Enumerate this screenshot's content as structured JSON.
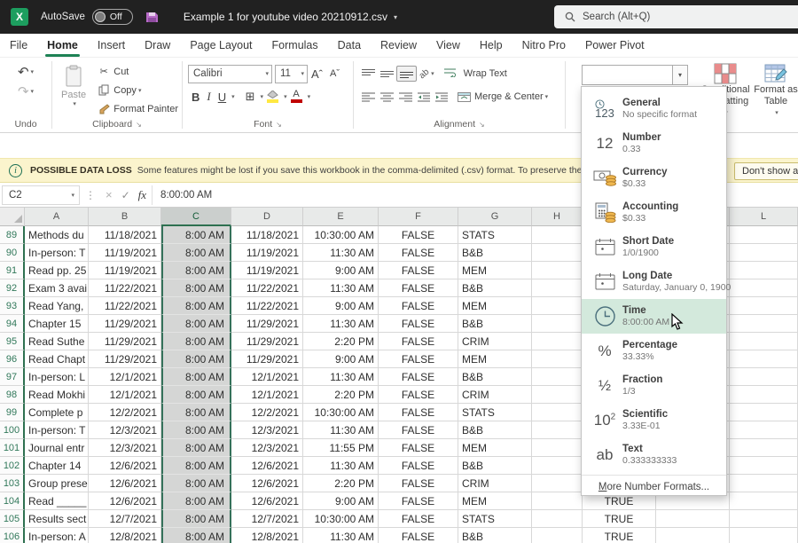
{
  "titlebar": {
    "autosave_label": "AutoSave",
    "autosave_state": "Off",
    "filename": "Example 1 for youtube video 20210912.csv",
    "search_placeholder": "Search (Alt+Q)"
  },
  "tabs": {
    "items": [
      "File",
      "Home",
      "Insert",
      "Draw",
      "Page Layout",
      "Formulas",
      "Data",
      "Review",
      "View",
      "Help",
      "Nitro Pro",
      "Power Pivot"
    ],
    "active": "Home"
  },
  "ribbon": {
    "undo": {
      "label": "Undo"
    },
    "clipboard": {
      "label": "Clipboard",
      "paste": "Paste",
      "cut": "Cut",
      "copy": "Copy",
      "format_painter": "Format Painter"
    },
    "font": {
      "label": "Font",
      "font_name": "Calibri",
      "font_size": "11"
    },
    "alignment": {
      "label": "Alignment",
      "wrap_text": "Wrap Text",
      "merge_center": "Merge & Center"
    },
    "number": {
      "combobox_value": ""
    },
    "styles": {
      "conditional_formatting": "Conditional Formatting",
      "format_as_table": "Format as Table"
    }
  },
  "message_bar": {
    "badge": "POSSIBLE DATA LOSS",
    "text": "Some features might be lost if you save this workbook in the comma-delimited (.csv) format. To preserve these feat",
    "button": "Don't show a"
  },
  "formula_bar": {
    "name_box": "C2",
    "value": "8:00:00 AM"
  },
  "grid": {
    "columns": [
      "A",
      "B",
      "C",
      "D",
      "E",
      "F",
      "G",
      "H",
      "",
      "",
      "L"
    ],
    "selected_column": "C",
    "rows": [
      {
        "n": 89,
        "a": "Methods du",
        "b": "11/18/2021",
        "c": "8:00 AM",
        "d": "11/18/2021",
        "e": "10:30:00 AM",
        "f": "FALSE",
        "g": "STATS",
        "i": ""
      },
      {
        "n": 90,
        "a": "In-person: T",
        "b": "11/19/2021",
        "c": "8:00 AM",
        "d": "11/19/2021",
        "e": "11:30 AM",
        "f": "FALSE",
        "g": "B&B",
        "i": ""
      },
      {
        "n": 91,
        "a": "Read pp. 25",
        "b": "11/19/2021",
        "c": "8:00 AM",
        "d": "11/19/2021",
        "e": "9:00 AM",
        "f": "FALSE",
        "g": "MEM",
        "i": ""
      },
      {
        "n": 92,
        "a": "Exam 3 avai",
        "b": "11/22/2021",
        "c": "8:00 AM",
        "d": "11/22/2021",
        "e": "11:30 AM",
        "f": "FALSE",
        "g": "B&B",
        "i": ""
      },
      {
        "n": 93,
        "a": "Read Yang,",
        "b": "11/22/2021",
        "c": "8:00 AM",
        "d": "11/22/2021",
        "e": "9:00 AM",
        "f": "FALSE",
        "g": "MEM",
        "i": ""
      },
      {
        "n": 94,
        "a": "Chapter 15",
        "b": "11/29/2021",
        "c": "8:00 AM",
        "d": "11/29/2021",
        "e": "11:30 AM",
        "f": "FALSE",
        "g": "B&B",
        "i": ""
      },
      {
        "n": 95,
        "a": "Read Suthe",
        "b": "11/29/2021",
        "c": "8:00 AM",
        "d": "11/29/2021",
        "e": "2:20 PM",
        "f": "FALSE",
        "g": "CRIM",
        "i": ""
      },
      {
        "n": 96,
        "a": "Read Chapt",
        "b": "11/29/2021",
        "c": "8:00 AM",
        "d": "11/29/2021",
        "e": "9:00 AM",
        "f": "FALSE",
        "g": "MEM",
        "i": ""
      },
      {
        "n": 97,
        "a": "In-person: L",
        "b": "12/1/2021",
        "c": "8:00 AM",
        "d": "12/1/2021",
        "e": "11:30 AM",
        "f": "FALSE",
        "g": "B&B",
        "i": ""
      },
      {
        "n": 98,
        "a": "Read Mokhi",
        "b": "12/1/2021",
        "c": "8:00 AM",
        "d": "12/1/2021",
        "e": "2:20 PM",
        "f": "FALSE",
        "g": "CRIM",
        "i": ""
      },
      {
        "n": 99,
        "a": "Complete p",
        "b": "12/2/2021",
        "c": "8:00 AM",
        "d": "12/2/2021",
        "e": "10:30:00 AM",
        "f": "FALSE",
        "g": "STATS",
        "i": ""
      },
      {
        "n": 100,
        "a": "In-person: T",
        "b": "12/3/2021",
        "c": "8:00 AM",
        "d": "12/3/2021",
        "e": "11:30 AM",
        "f": "FALSE",
        "g": "B&B",
        "i": ""
      },
      {
        "n": 101,
        "a": "Journal entr",
        "b": "12/3/2021",
        "c": "8:00 AM",
        "d": "12/3/2021",
        "e": "11:55 PM",
        "f": "FALSE",
        "g": "MEM",
        "i": ""
      },
      {
        "n": 102,
        "a": "Chapter 14",
        "b": "12/6/2021",
        "c": "8:00 AM",
        "d": "12/6/2021",
        "e": "11:30 AM",
        "f": "FALSE",
        "g": "B&B",
        "i": ""
      },
      {
        "n": 103,
        "a": "Group prese",
        "b": "12/6/2021",
        "c": "8:00 AM",
        "d": "12/6/2021",
        "e": "2:20 PM",
        "f": "FALSE",
        "g": "CRIM",
        "i": ""
      },
      {
        "n": 104,
        "a": "Read _____",
        "b": "12/6/2021",
        "c": "8:00 AM",
        "d": "12/6/2021",
        "e": "9:00 AM",
        "f": "FALSE",
        "g": "MEM",
        "i": "TRUE"
      },
      {
        "n": 105,
        "a": "Results sect",
        "b": "12/7/2021",
        "c": "8:00 AM",
        "d": "12/7/2021",
        "e": "10:30:00 AM",
        "f": "FALSE",
        "g": "STATS",
        "i": "TRUE"
      },
      {
        "n": 106,
        "a": "In-person: A",
        "b": "12/8/2021",
        "c": "8:00 AM",
        "d": "12/8/2021",
        "e": "11:30 AM",
        "f": "FALSE",
        "g": "B&B",
        "i": "TRUE"
      }
    ]
  },
  "format_dropdown": {
    "items": [
      {
        "icon": "general-icon",
        "title": "General",
        "subtitle": "No specific format",
        "highlighted": false
      },
      {
        "icon": "number-icon",
        "title": "Number",
        "subtitle": "0.33",
        "highlighted": false
      },
      {
        "icon": "currency-icon",
        "title": "Currency",
        "subtitle": "$0.33",
        "highlighted": false
      },
      {
        "icon": "accounting-icon",
        "title": "Accounting",
        "subtitle": "$0.33",
        "highlighted": false
      },
      {
        "icon": "short-date-icon",
        "title": "Short Date",
        "subtitle": "1/0/1900",
        "highlighted": false
      },
      {
        "icon": "long-date-icon",
        "title": "Long Date",
        "subtitle": "Saturday, January 0, 1900",
        "highlighted": false
      },
      {
        "icon": "time-icon",
        "title": "Time",
        "subtitle": "8:00:00 AM",
        "highlighted": true
      },
      {
        "icon": "percentage-icon",
        "title": "Percentage",
        "subtitle": "33.33%",
        "highlighted": false
      },
      {
        "icon": "fraction-icon",
        "title": "Fraction",
        "subtitle": "1/3",
        "highlighted": false
      },
      {
        "icon": "scientific-icon",
        "title": "Scientific",
        "subtitle": "3.33E-01",
        "highlighted": false
      },
      {
        "icon": "text-icon",
        "title": "Text",
        "subtitle": "0.333333333",
        "highlighted": false
      }
    ],
    "footer": "More Number Formats..."
  },
  "colors": {
    "accent_green": "#217346",
    "selection_green": "#2e7050",
    "highlight_green": "#d3e9dc",
    "warning_bg": "#fbf4cd",
    "titlebar_bg": "#212121"
  }
}
